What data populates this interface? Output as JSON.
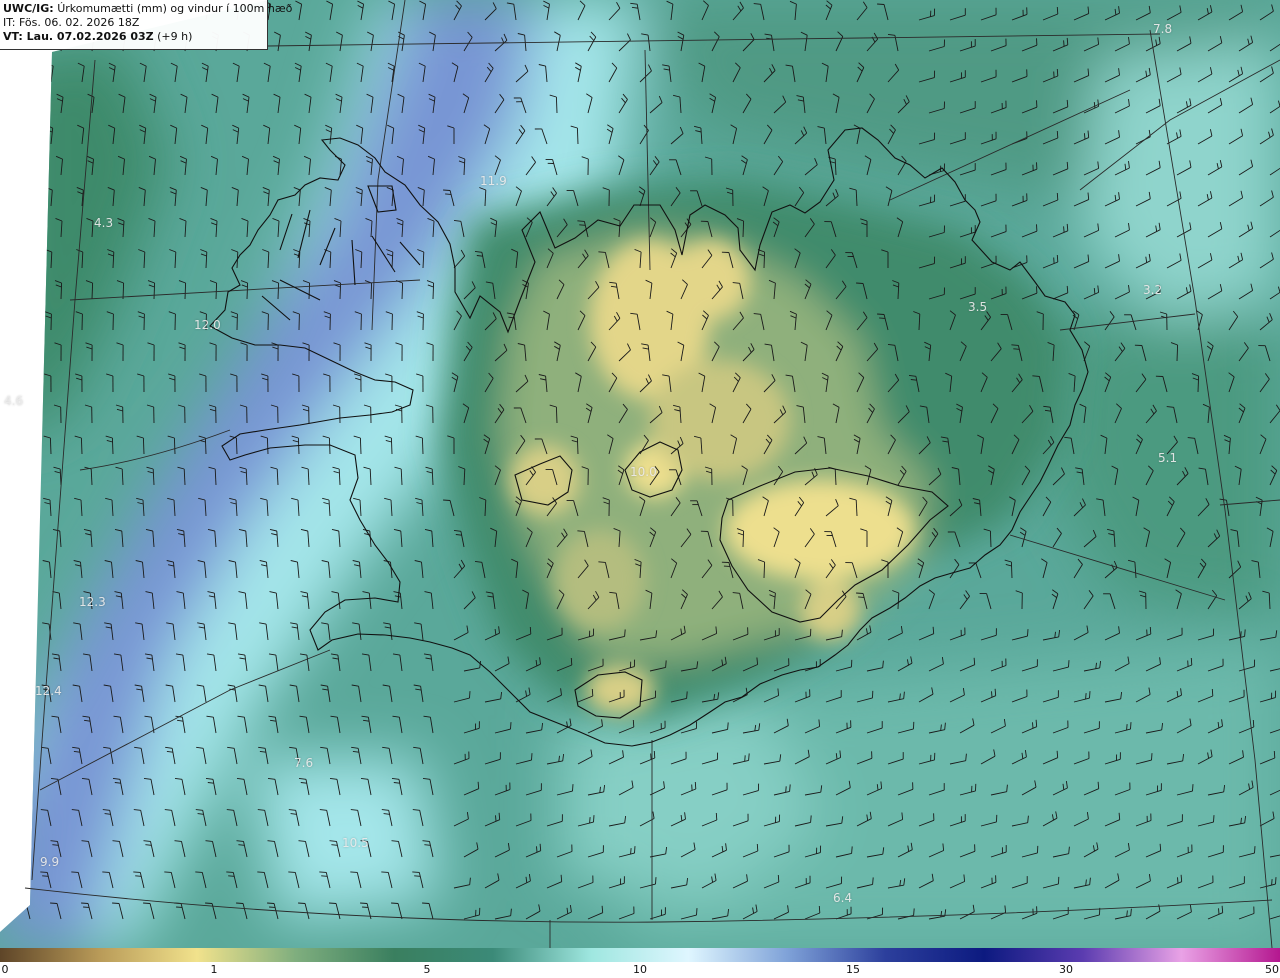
{
  "header": {
    "model": "UWC/IG:",
    "field": "Úrkomumætti (mm) og vindur í 100m hæð",
    "it_line": "IT: Fös. 06. 02. 2026 18Z",
    "vt_label": "VT: Lau. 07.02.2026 03Z",
    "vt_offset": "(+9 h)"
  },
  "value_labels": [
    {
      "text": "4.3"
    },
    {
      "text": "12.0"
    },
    {
      "text": "4.6"
    },
    {
      "text": "11.9"
    },
    {
      "text": "10.0"
    },
    {
      "text": "3.5"
    },
    {
      "text": "5.1"
    },
    {
      "text": "12.3"
    },
    {
      "text": "12.4"
    },
    {
      "text": "9.9"
    },
    {
      "text": "10.5"
    },
    {
      "text": "6.4"
    },
    {
      "text": "7.8"
    },
    {
      "text": "3.2"
    },
    {
      "text": "7.6"
    }
  ],
  "colorbar": {
    "ticks": [
      "0",
      "1",
      "5",
      "10",
      "15",
      "30",
      "50"
    ],
    "colors": [
      "#5e4528",
      "#b89a58",
      "#f1e28c",
      "#7fae7e",
      "#3a7f5f",
      "#3b8a78",
      "#9fe7e0",
      "#dff6ff",
      "#7fa2d8",
      "#2c3f9c",
      "#0c1a80",
      "#5b3cb0",
      "#e9a2e6",
      "#b4178f"
    ]
  },
  "colors": {
    "land_high": "#e3d689",
    "land_mid": "#8fb07b",
    "sea_green": "#3f8b6c",
    "sea_teal": "#69b8aa",
    "sea_cyan": "#b5ecef",
    "sea_blue": "#6d8fd0"
  }
}
